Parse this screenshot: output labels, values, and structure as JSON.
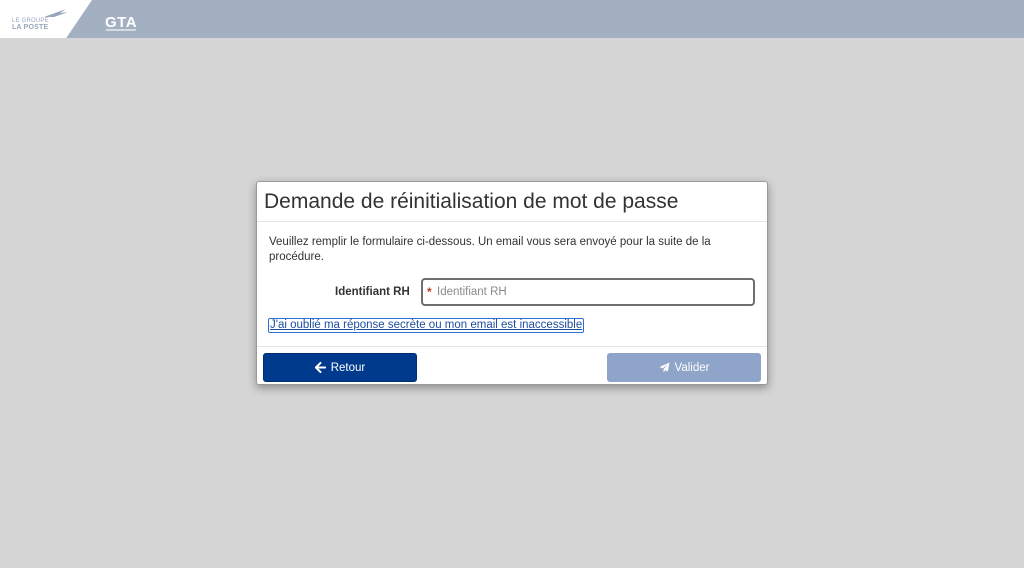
{
  "header": {
    "brand_line1": "LE GROUPE",
    "brand_line2": "LA POSTE",
    "app_name": "GTA",
    "brand_icon": "bird-logo-icon"
  },
  "modal": {
    "title": "Demande de réinitialisation de mot de passe",
    "intro": "Veuillez remplir le formulaire ci-dessous. Un email vous sera envoyé pour la suite de la procédure.",
    "field": {
      "label": "Identifiant RH",
      "required_marker": "*",
      "placeholder": "Identifiant RH",
      "value": ""
    },
    "forgot_link": "J'ai oublié ma réponse secrète ou mon email est inaccessible",
    "buttons": {
      "back_label": "Retour",
      "back_icon": "arrow-left-icon",
      "submit_label": "Valider",
      "submit_icon": "paper-plane-icon"
    }
  },
  "colors": {
    "background": "#d5d5d5",
    "header_bar": "#a3b0c2",
    "primary_button": "#003a8c",
    "disabled_button": "#8ea5c9",
    "link": "#1e4fa0",
    "required": "#c0392b"
  }
}
